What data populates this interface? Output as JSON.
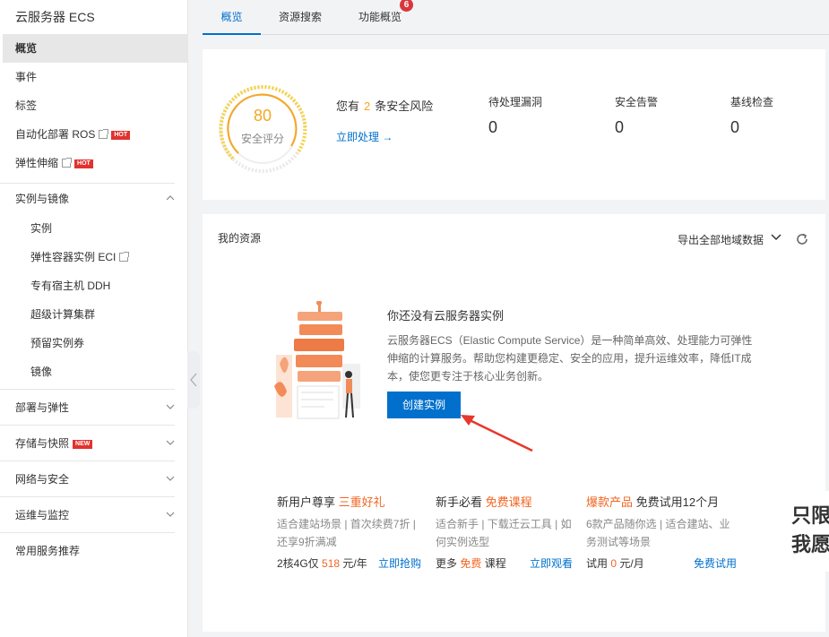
{
  "sidebar": {
    "title": "云服务器 ECS",
    "top_items": [
      {
        "label": "概览"
      },
      {
        "label": "事件"
      },
      {
        "label": "标签"
      },
      {
        "label": "自动化部署 ROS",
        "badge": "HOT"
      },
      {
        "label": "弹性伸缩",
        "badge": "HOT"
      }
    ],
    "group_instances": {
      "label": "实例与镜像",
      "items": [
        "实例",
        "弹性容器实例 ECI",
        "专有宿主机 DDH",
        "超级计算集群",
        "预留实例券",
        "镜像"
      ]
    },
    "groups": [
      {
        "label": "部署与弹性"
      },
      {
        "label": "存储与快照",
        "badge": "NEW"
      },
      {
        "label": "网络与安全"
      },
      {
        "label": "运维与监控"
      }
    ],
    "footer_item": "常用服务推荐"
  },
  "tabs": [
    {
      "label": "概览"
    },
    {
      "label": "资源搜索"
    },
    {
      "label": "功能概览"
    }
  ],
  "tab_count": "6",
  "security": {
    "score": "80",
    "score_label": "安全评分",
    "risk_prefix": "您有",
    "risk_count": "2",
    "risk_suffix": "条安全风险",
    "fix_link": "立即处理 →",
    "stats": [
      {
        "label": "待处理漏洞",
        "value": "0"
      },
      {
        "label": "安全告警",
        "value": "0"
      },
      {
        "label": "基线检查",
        "value": "0"
      }
    ]
  },
  "resources": {
    "title": "我的资源",
    "export_label": "导出全部地域数据",
    "empty_title": "你还没有云服务器实例",
    "empty_desc": "云服务器ECS（Elastic Compute Service）是一种简单高效、处理能力可弹性伸缩的计算服务。帮助您构建更稳定、安全的应用，提升运维效率，降低IT成本，使您更专注于核心业务创新。",
    "create_button": "创建实例"
  },
  "promos": [
    {
      "title_plain": "新用户尊享",
      "title_highlight": "三重好礼",
      "desc": "适合建站场景 | 首次续费7折 | 还享9折满减",
      "foot_plain": "2核4G仅",
      "foot_highlight": "518",
      "foot_suffix": "元/年",
      "link": "立即抢购"
    },
    {
      "title_plain": "新手必看",
      "title_highlight": "免费课程",
      "desc": "适合新手 | 下载迁云工具 | 如何实例选型",
      "foot_plain": "更多",
      "foot_highlight": "免费",
      "foot_suffix": "课程",
      "link": "立即观看"
    },
    {
      "title_plain": "免费试用12个月",
      "title_highlight": "爆款产品",
      "desc": "6款产品随你选 | 适合建站、业务测试等场景",
      "foot_plain": "试用",
      "foot_highlight": "0",
      "foot_suffix": "元/月",
      "link": "免费试用"
    }
  ],
  "overlay": {
    "line1": "只限",
    "line2": "我愿"
  },
  "colors": {
    "primary": "#0070cc",
    "warning": "#f5a623",
    "hot": "#e0332f",
    "promo_orange": "#f26522"
  }
}
